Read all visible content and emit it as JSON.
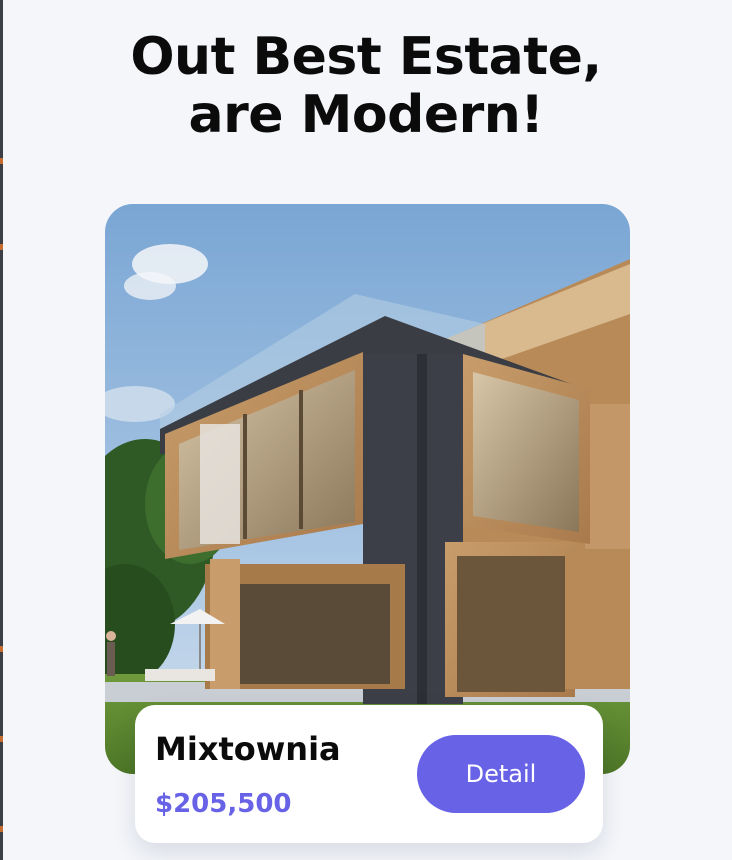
{
  "header": {
    "title_line1": "Out Best Estate,",
    "title_line2": "are Modern!"
  },
  "listing": {
    "name": "Mixtownia",
    "price": "$205,500",
    "detail_label": "Detail",
    "photo_subject": "modern-two-story-house-photo"
  },
  "colors": {
    "accent": "#6862e6",
    "background": "#f4f6fa",
    "text": "#0b0b0b"
  }
}
